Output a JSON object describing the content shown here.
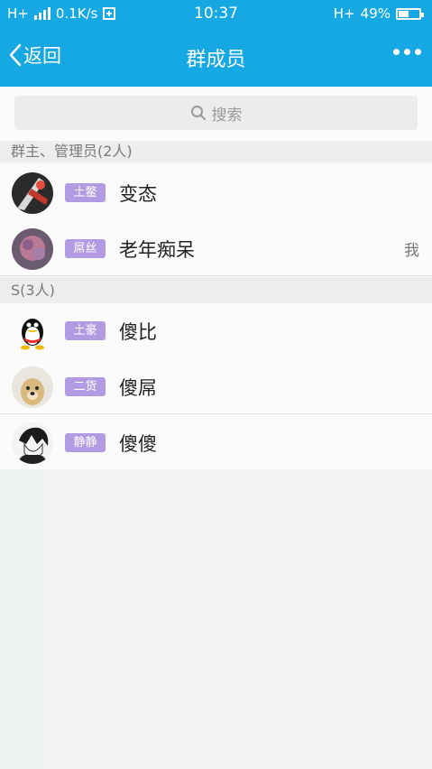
{
  "status_bar": {
    "network_left": "H+",
    "speed": "0.1K/s",
    "time": "10:37",
    "network_right": "H+",
    "battery": "49%"
  },
  "header": {
    "back_label": "返回",
    "title": "群成员"
  },
  "search": {
    "placeholder": "搜索"
  },
  "sections": [
    {
      "title": "群主、管理员(2人)",
      "members": [
        {
          "badge": "土鳖",
          "name": "变态",
          "suffix": ""
        },
        {
          "badge": "屌丝",
          "name": "老年痴呆",
          "suffix": "我"
        }
      ]
    },
    {
      "title": "S(3人)",
      "members": [
        {
          "badge": "土豪",
          "name": "傻比",
          "suffix": ""
        },
        {
          "badge": "二货",
          "name": "傻屌",
          "suffix": ""
        },
        {
          "badge": "静静",
          "name": "傻傻",
          "suffix": ""
        }
      ]
    }
  ],
  "colors": {
    "accent": "#15a8e3",
    "badge": "#b39be3"
  }
}
